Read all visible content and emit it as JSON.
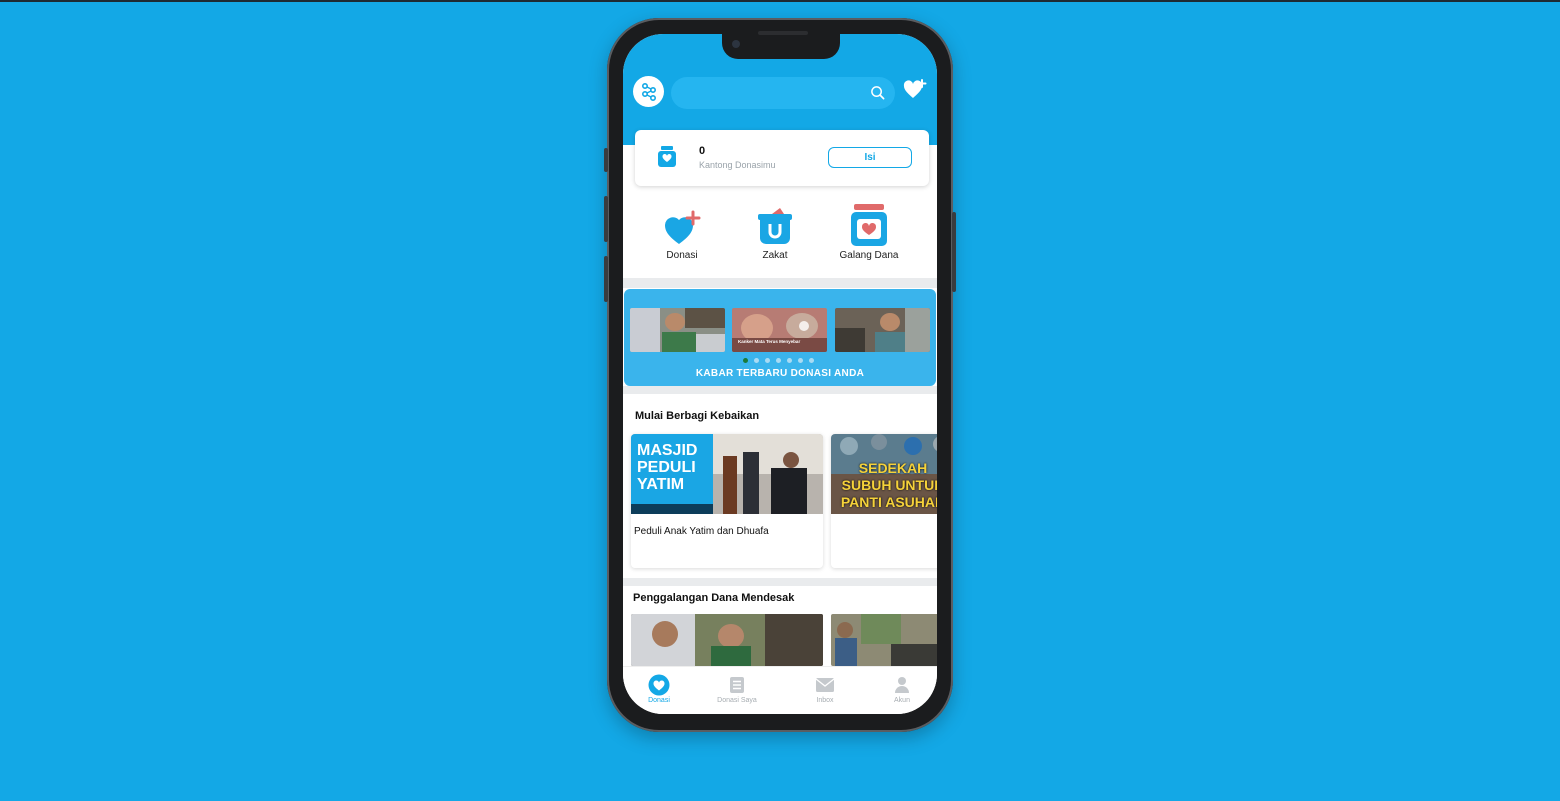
{
  "colors": {
    "background": "#13a8e6",
    "accent": "#13a8e6",
    "heart_plus": "#e06a6a"
  },
  "search": {
    "placeholder": ""
  },
  "pocket": {
    "amount": "0",
    "label": "Kantong Donasimu",
    "topup_label": "Isi"
  },
  "menu": [
    {
      "label": "Donasi",
      "icon": "heart-plus-icon"
    },
    {
      "label": "Zakat",
      "icon": "zakat-box-icon"
    },
    {
      "label": "Galang Dana",
      "icon": "fundraise-jar-icon"
    }
  ],
  "news": {
    "title": "KABAR TERBARU DONASI ANDA",
    "slides": [
      {
        "caption": ""
      },
      {
        "caption": "Kanker Mata Terus Menyebar"
      },
      {
        "caption": ""
      }
    ],
    "active_slide": 0,
    "slide_count": 7
  },
  "section_kebaikan": {
    "title": "Mulai Berbagi Kebaikan",
    "cards": [
      {
        "title": "Peduli Anak Yatim dan Dhuafa",
        "image_text": "MASJID PEDULI YATIM"
      },
      {
        "title": "",
        "image_text": "SEDEKAH SUBUH UNTUK PANTI ASUHAN"
      }
    ]
  },
  "section_mendesak": {
    "title": "Penggalangan Dana Mendesak"
  },
  "tabs": [
    {
      "label": "Donasi",
      "icon": "heart-icon",
      "active": true
    },
    {
      "label": "Donasi Saya",
      "icon": "list-icon",
      "active": false
    },
    {
      "label": "Inbox",
      "icon": "mail-icon",
      "active": false
    },
    {
      "label": "Akun",
      "icon": "user-icon",
      "active": false
    }
  ]
}
